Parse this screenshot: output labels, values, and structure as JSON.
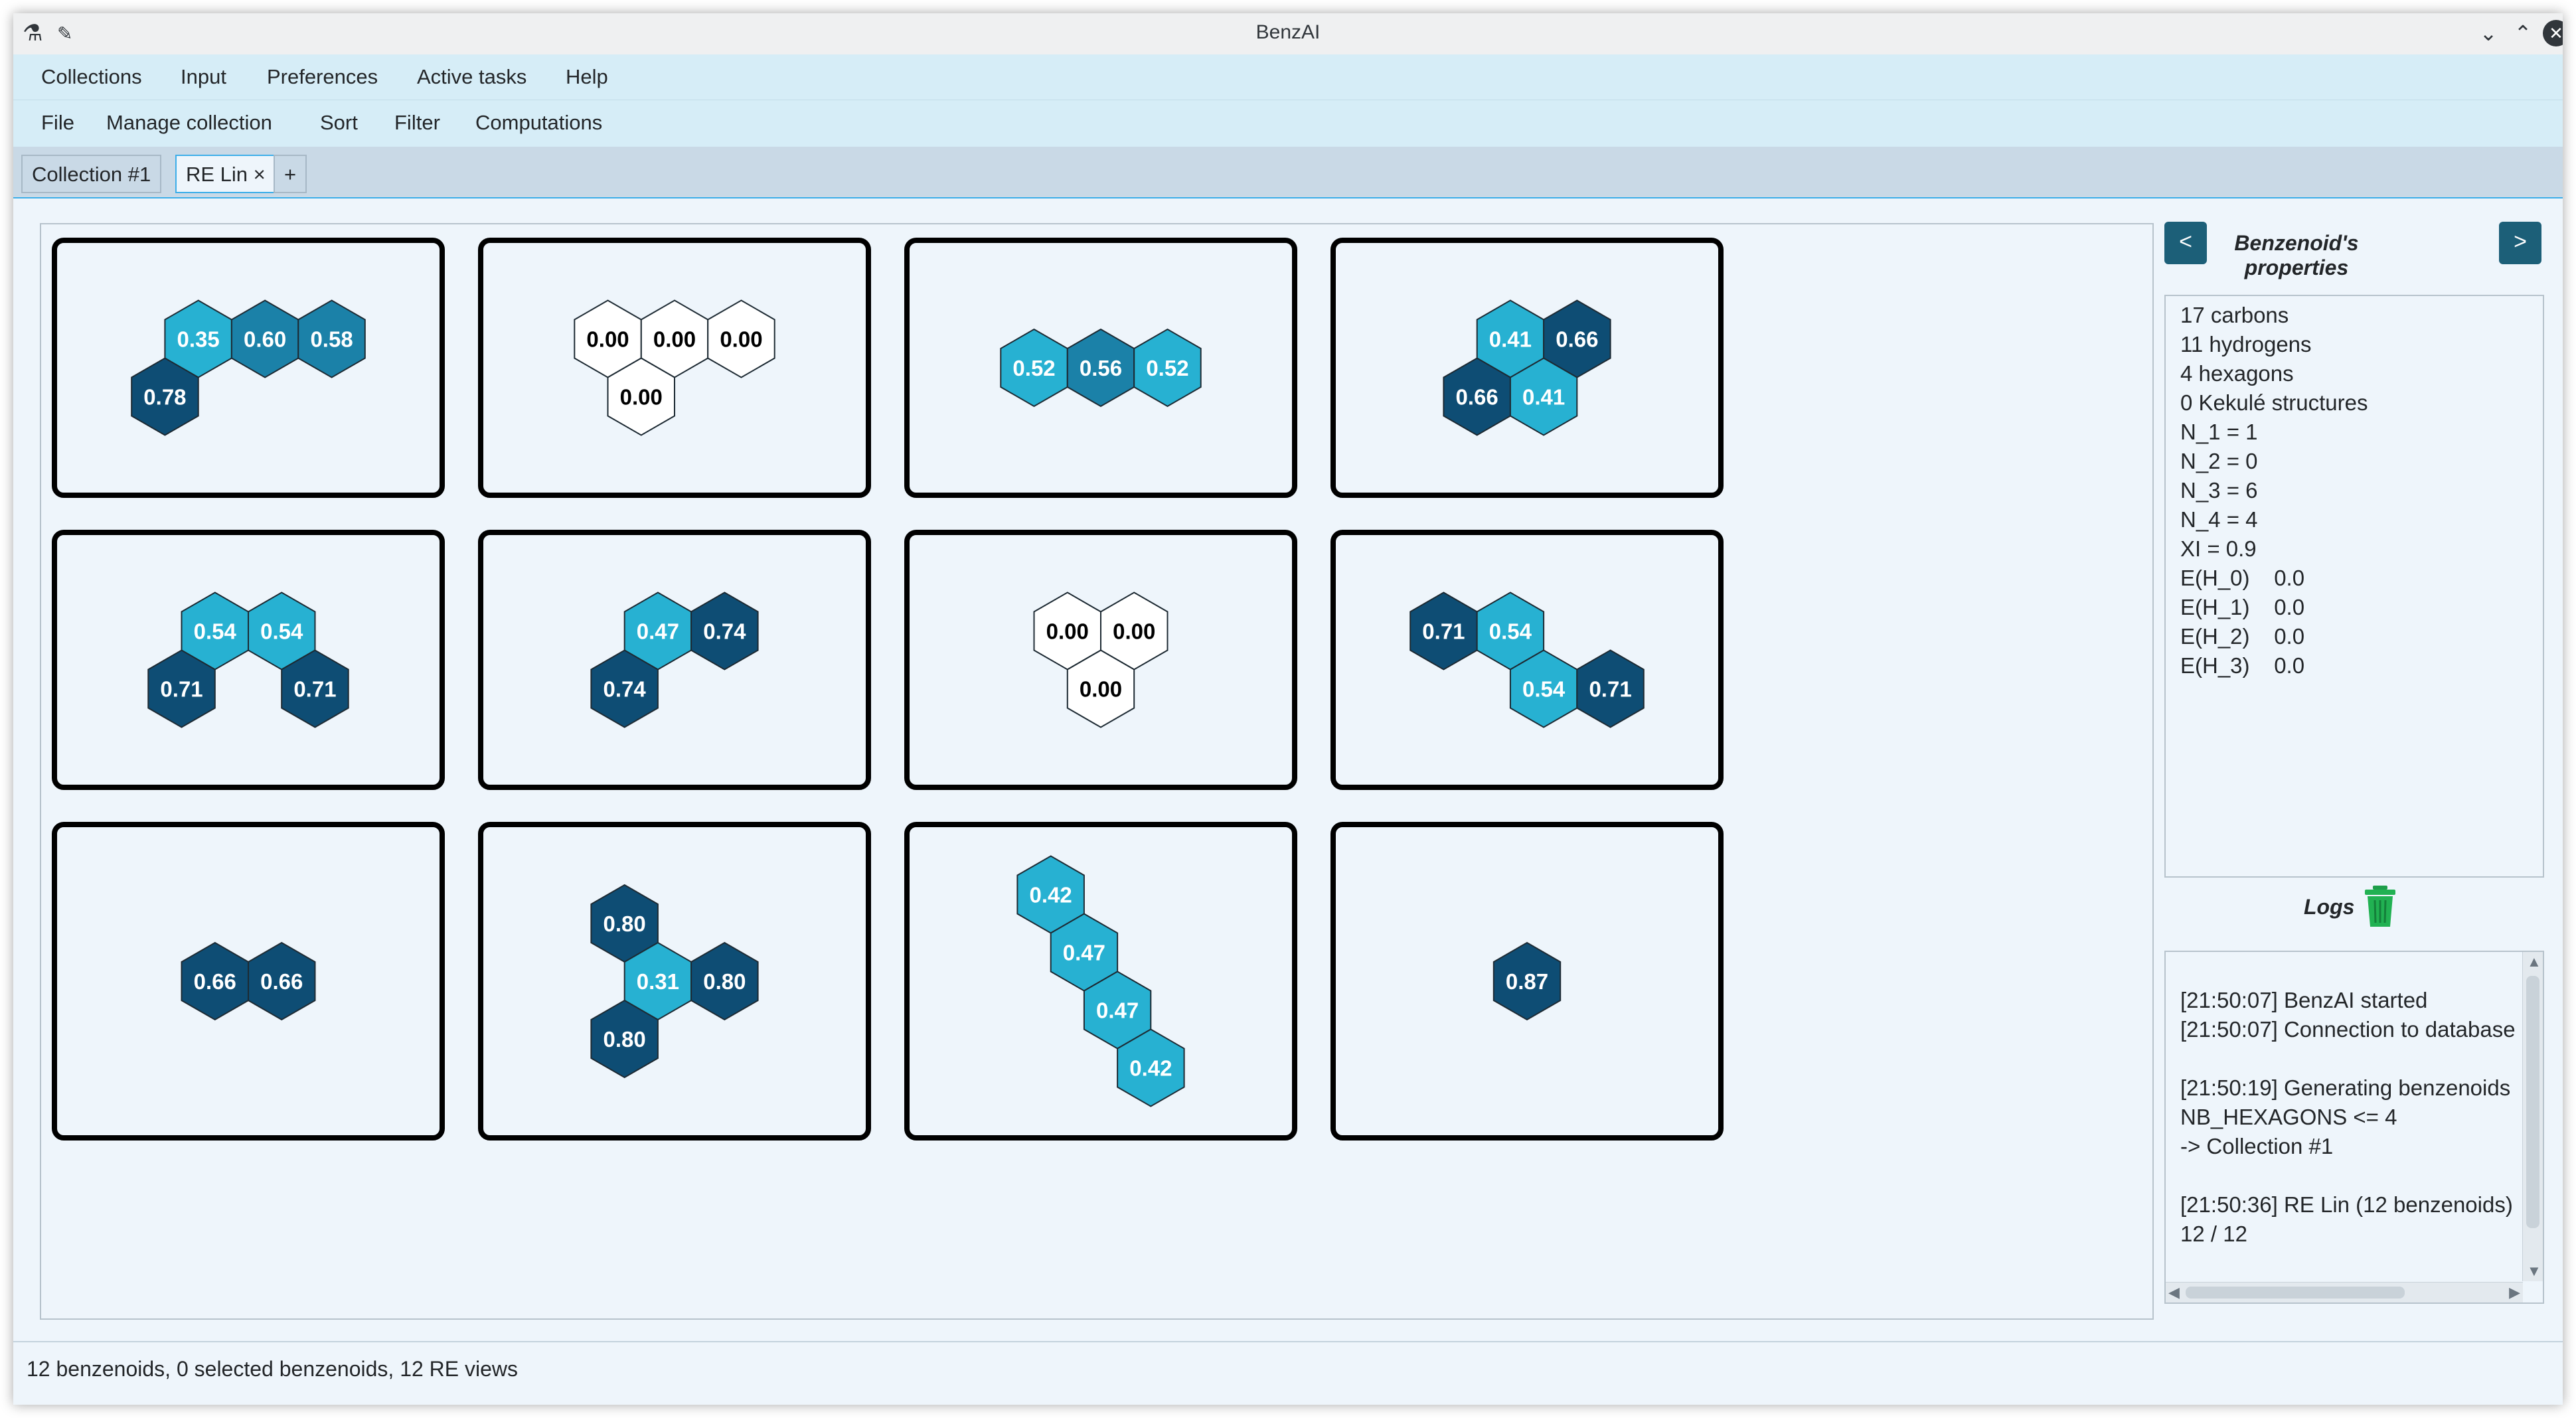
{
  "window": {
    "title": "BenzAI"
  },
  "menubar": {
    "items": [
      "Collections",
      "Input",
      "Preferences",
      "Active tasks",
      "Help"
    ]
  },
  "toolbar": {
    "items": [
      "File",
      "Manage collection",
      "Sort",
      "Filter",
      "Computations"
    ]
  },
  "tabs": {
    "items": [
      "Collection #1",
      "RE Lin"
    ],
    "close_glyph": "×",
    "add_label": "+",
    "active": "RE Lin"
  },
  "colors": {
    "light": "#27b1d2",
    "mid": "#1b81a8",
    "dark": "#0e4d74",
    "empty": "#ffffff"
  },
  "benzenoids": [
    {
      "hexagons": [
        {
          "q": 1,
          "r": 0,
          "value": "0.35"
        },
        {
          "q": 2,
          "r": 0,
          "value": "0.60"
        },
        {
          "q": 3,
          "r": 0,
          "value": "0.58"
        },
        {
          "q": 0,
          "r": 1,
          "value": "0.78"
        }
      ]
    },
    {
      "hexagons": [
        {
          "q": 0,
          "r": 0,
          "value": "0.00"
        },
        {
          "q": 1,
          "r": 0,
          "value": "0.00"
        },
        {
          "q": 2,
          "r": 0,
          "value": "0.00"
        },
        {
          "q": 0,
          "r": 1,
          "value": "0.00"
        }
      ]
    },
    {
      "hexagons": [
        {
          "q": 0,
          "r": 0,
          "value": "0.52"
        },
        {
          "q": 1,
          "r": 0,
          "value": "0.56"
        },
        {
          "q": 2,
          "r": 0,
          "value": "0.52"
        }
      ]
    },
    {
      "hexagons": [
        {
          "q": 1,
          "r": 0,
          "value": "0.41"
        },
        {
          "q": 2,
          "r": 0,
          "value": "0.66"
        },
        {
          "q": 0,
          "r": 1,
          "value": "0.66"
        },
        {
          "q": 1,
          "r": 1,
          "value": "0.41"
        }
      ]
    },
    {
      "hexagons": [
        {
          "q": 1,
          "r": 0,
          "value": "0.54"
        },
        {
          "q": 2,
          "r": 0,
          "value": "0.54"
        },
        {
          "q": 0,
          "r": 1,
          "value": "0.71"
        },
        {
          "q": 2,
          "r": 1,
          "value": "0.71"
        }
      ]
    },
    {
      "hexagons": [
        {
          "q": 1,
          "r": 0,
          "value": "0.47"
        },
        {
          "q": 2,
          "r": 0,
          "value": "0.74"
        },
        {
          "q": 0,
          "r": 1,
          "value": "0.74"
        }
      ]
    },
    {
      "hexagons": [
        {
          "q": 0,
          "r": 0,
          "value": "0.00"
        },
        {
          "q": 1,
          "r": 0,
          "value": "0.00"
        },
        {
          "q": 0,
          "r": 1,
          "value": "0.00"
        }
      ]
    },
    {
      "hexagons": [
        {
          "q": 0,
          "r": 0,
          "value": "0.71"
        },
        {
          "q": 1,
          "r": 0,
          "value": "0.54"
        },
        {
          "q": 1,
          "r": 1,
          "value": "0.54"
        },
        {
          "q": 2,
          "r": 1,
          "value": "0.71"
        }
      ]
    },
    {
      "hexagons": [
        {
          "q": 0,
          "r": 0,
          "value": "0.66"
        },
        {
          "q": 1,
          "r": 0,
          "value": "0.66"
        }
      ]
    },
    {
      "hexagons": [
        {
          "q": 0,
          "r": 0,
          "value": "0.80"
        },
        {
          "q": 0,
          "r": 1,
          "value": "0.31"
        },
        {
          "q": 1,
          "r": 1,
          "value": "0.80"
        },
        {
          "q": -1,
          "r": 2,
          "value": "0.80"
        }
      ]
    },
    {
      "hexagons": [
        {
          "q": 0,
          "r": 0,
          "value": "0.42"
        },
        {
          "q": 0,
          "r": 1,
          "value": "0.47"
        },
        {
          "q": 0,
          "r": 2,
          "value": "0.47"
        },
        {
          "q": 0,
          "r": 3,
          "value": "0.42"
        }
      ]
    },
    {
      "hexagons": [
        {
          "q": 0,
          "r": 0,
          "value": "0.87"
        }
      ]
    }
  ],
  "properties": {
    "title": "Benzenoid's properties",
    "prev_label": "<",
    "next_label": ">",
    "lines": [
      "17 carbons",
      "11 hydrogens",
      "4 hexagons",
      "0 Kekulé structures",
      "N_1 = 1",
      "N_2 = 0",
      "N_3 = 6",
      "N_4 = 4",
      "XI = 0.9",
      "E(H_0)    0.0",
      "E(H_1)    0.0",
      "E(H_2)    0.0",
      "E(H_3)    0.0"
    ]
  },
  "logs": {
    "title": "Logs",
    "lines": [
      "",
      "[21:50:07] BenzAI started",
      "[21:50:07] Connection to database",
      "",
      "[21:50:19] Generating benzenoids",
      "NB_HEXAGONS <= 4",
      "-> Collection #1",
      "",
      "[21:50:36] RE Lin (12 benzenoids)",
      "12 / 12"
    ]
  },
  "status": {
    "text": "12 benzenoids, 0 selected benzenoids, 12 RE views"
  }
}
